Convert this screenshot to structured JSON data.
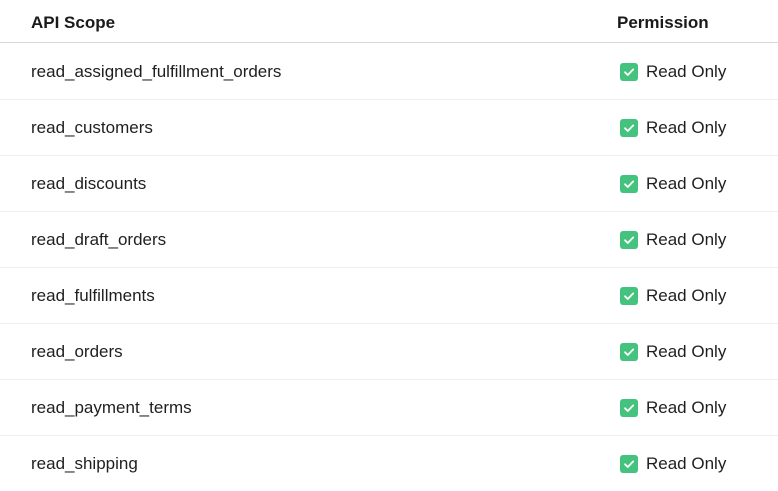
{
  "table": {
    "columns": {
      "scope": "API Scope",
      "permission": "Permission"
    },
    "rows": [
      {
        "scope": "read_assigned_fulfillment_orders",
        "permission": "Read Only",
        "icon": "checkmark-icon"
      },
      {
        "scope": "read_customers",
        "permission": "Read Only",
        "icon": "checkmark-icon"
      },
      {
        "scope": "read_discounts",
        "permission": "Read Only",
        "icon": "checkmark-icon"
      },
      {
        "scope": "read_draft_orders",
        "permission": "Read Only",
        "icon": "checkmark-icon"
      },
      {
        "scope": "read_fulfillments",
        "permission": "Read Only",
        "icon": "checkmark-icon"
      },
      {
        "scope": "read_orders",
        "permission": "Read Only",
        "icon": "checkmark-icon"
      },
      {
        "scope": "read_payment_terms",
        "permission": "Read Only",
        "icon": "checkmark-icon"
      },
      {
        "scope": "read_shipping",
        "permission": "Read Only",
        "icon": "checkmark-icon"
      }
    ]
  },
  "colors": {
    "check_background": "#43c37d",
    "header_border": "#d9d9d9",
    "row_border": "#efefef"
  }
}
